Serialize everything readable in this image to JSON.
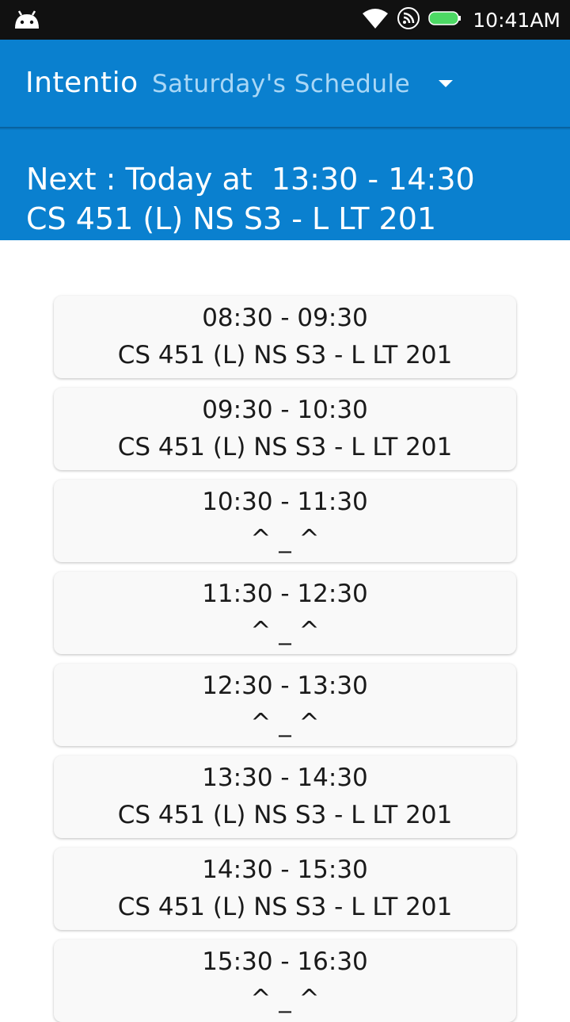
{
  "status_bar": {
    "time": "10:41AM",
    "icons": [
      "android-icon",
      "wifi-icon",
      "cast-icon",
      "battery-icon"
    ],
    "battery_color": "#4CD964"
  },
  "app_bar": {
    "title": "Intentio",
    "schedule_label": "Saturday's Schedule",
    "background": "#0A80CF"
  },
  "next": {
    "line1": "Next : Today at  13:30 - 14:30",
    "line2": "CS 451 (L) NS S3 - L LT 201"
  },
  "slots": [
    {
      "time": "08:30 - 09:30",
      "course": "CS 451 (L) NS S3 - L LT 201"
    },
    {
      "time": "09:30 - 10:30",
      "course": "CS 451 (L) NS S3 - L LT 201"
    },
    {
      "time": "10:30 - 11:30",
      "course": "^ _ ^"
    },
    {
      "time": "11:30 - 12:30",
      "course": "^ _ ^"
    },
    {
      "time": "12:30 - 13:30",
      "course": "^ _ ^"
    },
    {
      "time": "13:30 - 14:30",
      "course": "CS 451 (L) NS S3 - L LT 201"
    },
    {
      "time": "14:30 - 15:30",
      "course": "CS 451 (L) NS S3 - L LT 201"
    },
    {
      "time": "15:30 - 16:30",
      "course": "^ _ ^"
    }
  ]
}
